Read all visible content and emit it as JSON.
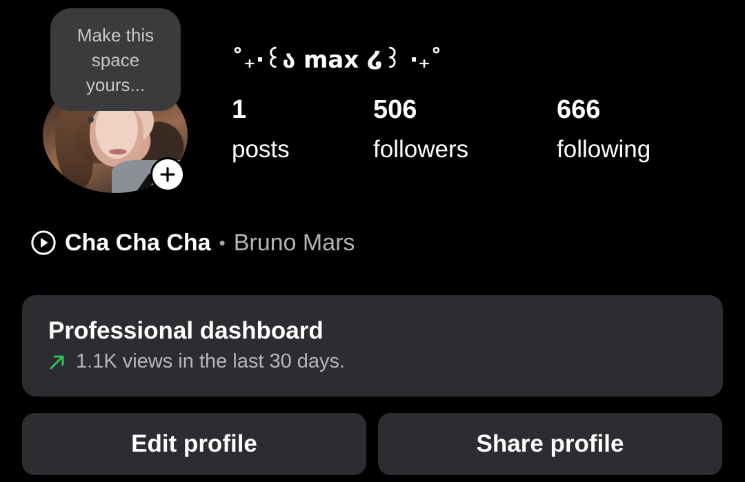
{
  "profile": {
    "username": "˚₊‧꒰ა max ໒꒱ ‧₊˚",
    "note": "Make this\nspace\nyours...",
    "avatar_action_icon": "plus-icon"
  },
  "stats": {
    "posts": {
      "value": "1",
      "label": "posts"
    },
    "followers": {
      "value": "506",
      "label": "followers"
    },
    "following": {
      "value": "666",
      "label": "following"
    }
  },
  "music": {
    "icon": "play-circle-icon",
    "title": "Cha Cha Cha",
    "separator": "•",
    "artist": "Bruno Mars"
  },
  "dashboard": {
    "title": "Professional dashboard",
    "subtitle": "1.1K views in the last 30 days.",
    "trend_icon": "trend-up-arrow-icon",
    "trend_color": "#34c759"
  },
  "buttons": {
    "edit": "Edit profile",
    "share": "Share profile"
  },
  "colors": {
    "background": "#000000",
    "card": "#2b2d31",
    "note_bubble": "#3a3b3d"
  }
}
